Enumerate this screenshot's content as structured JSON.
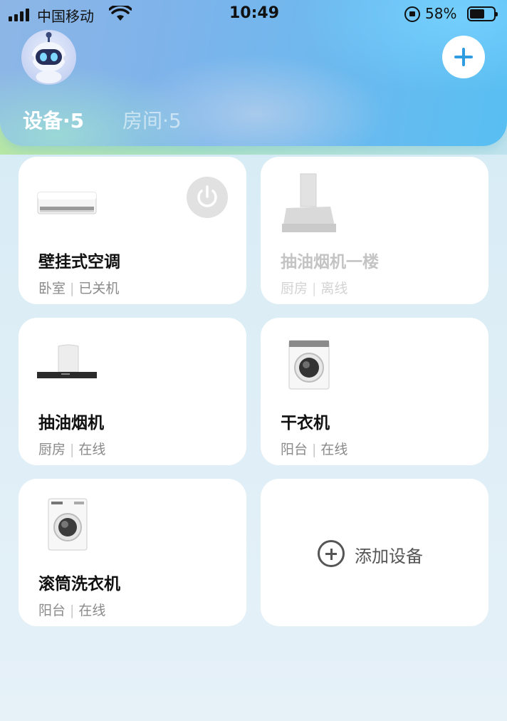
{
  "status_bar": {
    "carrier": "中国移动",
    "time": "10:49",
    "battery": "58%"
  },
  "header": {
    "avatar_icon": "robot-avatar-icon",
    "add_icon": "plus-icon",
    "tabs": [
      {
        "label": "设备·5",
        "active": true
      },
      {
        "label": "房间·5",
        "active": false
      }
    ]
  },
  "devices": [
    {
      "name": "壁挂式空调",
      "room": "卧室",
      "status": "已关机",
      "icon": "air-conditioner-icon",
      "online": true
    },
    {
      "name": "抽油烟机一楼",
      "room": "厨房",
      "status": "离线",
      "icon": "range-hood-icon",
      "online": false
    },
    {
      "name": "抽油烟机",
      "room": "厨房",
      "status": "在线",
      "icon": "range-hood-icon",
      "online": true
    },
    {
      "name": "干衣机",
      "room": "阳台",
      "status": "在线",
      "icon": "dryer-icon",
      "online": true
    },
    {
      "name": "滚筒洗衣机",
      "room": "阳台",
      "status": "在线",
      "icon": "washing-machine-icon",
      "online": true
    }
  ],
  "add_device": {
    "label": "添加设备",
    "icon": "plus-circle-icon"
  },
  "colors": {
    "accent": "#2f9be0",
    "offline_text": "#c4c4c4"
  }
}
